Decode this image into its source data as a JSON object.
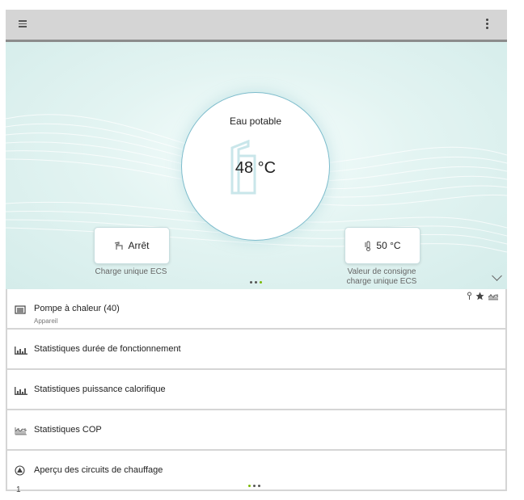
{
  "topbar": {
    "menu_icon": "hamburger-menu-icon",
    "more_icon": "more-vertical-icon"
  },
  "hero": {
    "circle_title": "Eau potable",
    "temperature": "48 °C",
    "left_button": {
      "label": "Arrêt",
      "icon": "faucet-icon",
      "caption": "Charge unique ECS"
    },
    "right_button": {
      "label": "50 °C",
      "icon": "thermometer-icon",
      "caption_line1": "Valeur de consigne",
      "caption_line2": "charge unique ECS"
    },
    "page_dots": {
      "count": 3,
      "active_index": 2
    },
    "colors": {
      "accent": "#7ab800",
      "circle_border": "#7dbccc"
    }
  },
  "list": {
    "items": [
      {
        "label": "Pompe à chaleur (40)",
        "sub": "Appareil",
        "icon": "device-icon"
      },
      {
        "label": "Statistiques durée de fonctionnement",
        "icon": "bar-chart-icon"
      },
      {
        "label": "Statistiques puissance calorifique",
        "icon": "bar-chart-icon"
      },
      {
        "label": "Statistiques COP",
        "icon": "cop-chart-icon"
      },
      {
        "label": "Aperçu des circuits de chauffage",
        "icon": "heating-circuit-icon",
        "icon_suffix": "1"
      }
    ],
    "page_dots": {
      "count": 3,
      "active_index": 0
    }
  }
}
